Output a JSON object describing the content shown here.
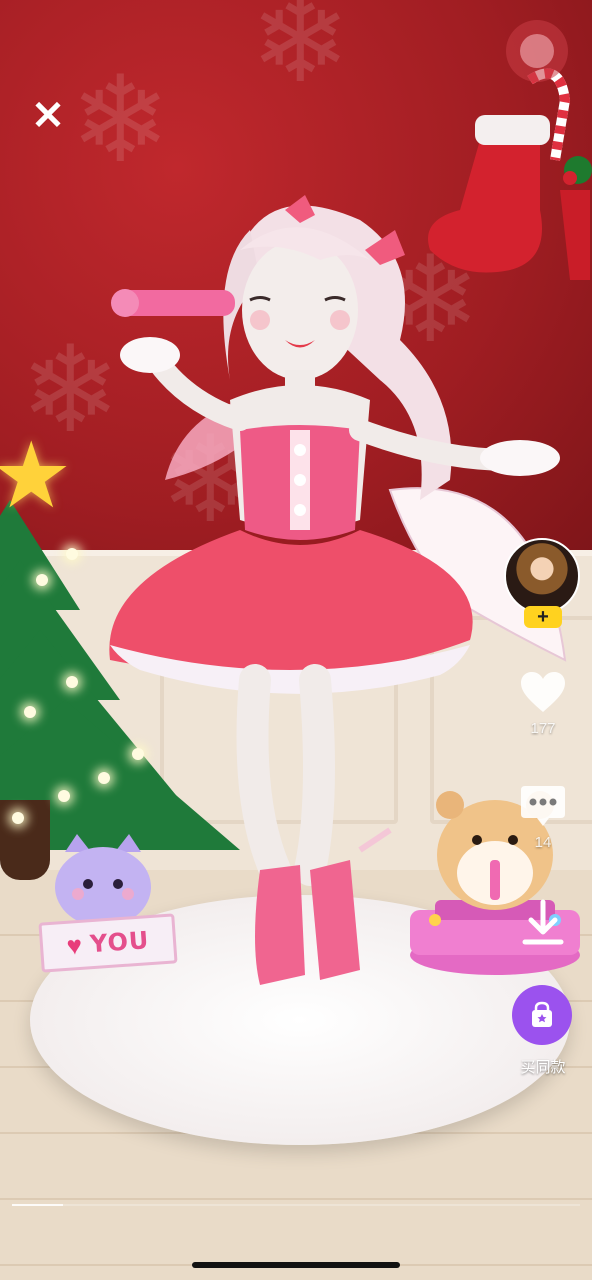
{
  "overlay": {
    "close_icon": "close-icon",
    "music_icon": "music-disc-icon",
    "follow_label": "+",
    "like_count": "177",
    "comment_count": "14",
    "download_icon": "download-icon",
    "buy_label": "买同款",
    "progress_fraction": 0.09
  },
  "scene": {
    "sign_text": "YOU"
  },
  "colors": {
    "wall": "#9f1d22",
    "accent_follow": "#ffd21f",
    "buy_button": "#9b52ee"
  }
}
